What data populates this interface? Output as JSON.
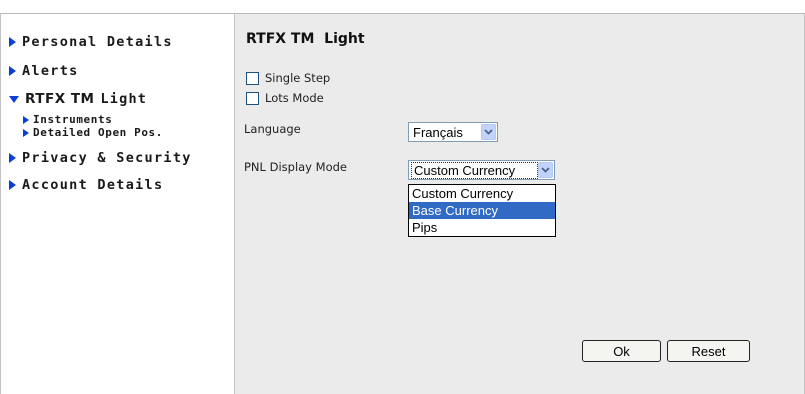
{
  "sidebar": {
    "items": [
      {
        "label": "Personal Details"
      },
      {
        "label": "Alerts"
      },
      {
        "label": "RTFX TM",
        "label_suffix": "Light"
      },
      {
        "label": "Privacy & Security"
      },
      {
        "label": "Account Details"
      }
    ],
    "sub_items": [
      {
        "label": "Instruments"
      },
      {
        "label": "Detailed Open Pos."
      }
    ]
  },
  "main": {
    "title": "RTFX TM  Light",
    "checkboxes": [
      {
        "label": "Single Step",
        "checked": false
      },
      {
        "label": "Lots Mode",
        "checked": false
      }
    ],
    "language": {
      "label": "Language",
      "value": "Français"
    },
    "pnl": {
      "label": "PNL Display Mode",
      "value": "Custom Currency",
      "options": [
        "Custom Currency",
        "Base Currency",
        "Pips"
      ],
      "highlighted": "Base Currency"
    },
    "buttons": {
      "ok": "Ok",
      "reset": "Reset"
    }
  },
  "colors": {
    "accent": "#0a3fd4",
    "panel_bg": "#ebebeb",
    "selection": "#316ac5"
  }
}
